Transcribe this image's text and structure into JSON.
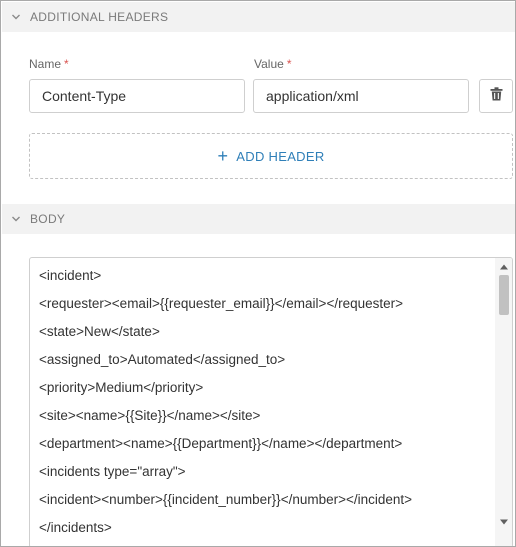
{
  "additional_headers": {
    "title": "ADDITIONAL HEADERS",
    "name_label": "Name",
    "value_label": "Value",
    "required_mark": "*",
    "name_value": "Content-Type",
    "value_value": "application/xml",
    "add_header_label": "ADD HEADER"
  },
  "body": {
    "title": "BODY",
    "lines": [
      "<incident>",
      "<requester><email>{{requester_email}}</email></requester>",
      "<state>New</state>",
      "<assigned_to>Automated</assigned_to>",
      "<priority>Medium</priority>",
      "<site><name>{{Site}}</name></site>",
      "<department><name>{{Department}}</name></department>",
      "<incidents type=\"array\">",
      "<incident><number>{{incident_number}}</number></incident>",
      "</incidents>"
    ]
  },
  "colors": {
    "accent": "#2f7fb8",
    "required": "#d9534f",
    "section_bg": "#f2f2f2"
  },
  "icons": {
    "collapse": "chevron-down-icon",
    "delete": "trash-icon",
    "add": "plus-icon"
  }
}
